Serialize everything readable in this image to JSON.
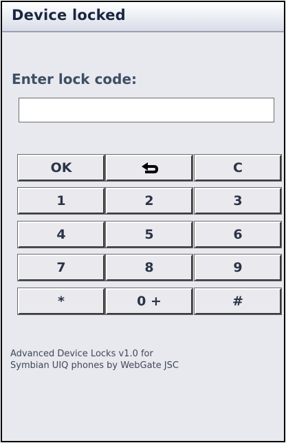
{
  "window": {
    "title": "Device locked"
  },
  "lock_form": {
    "prompt": "Enter lock code:",
    "code_value": ""
  },
  "keypad": {
    "ok": "OK",
    "backspace_icon": "backspace-arrow-icon",
    "clear": "C",
    "k1": "1",
    "k2": "2",
    "k3": "3",
    "k4": "4",
    "k5": "5",
    "k6": "6",
    "k7": "7",
    "k8": "8",
    "k9": "9",
    "star": "*",
    "zero": "0 +",
    "hash": "#"
  },
  "footer": {
    "line1": "Advanced Device Locks v1.0 for",
    "line2": "Symbian UIQ phones by WebGate JSC"
  },
  "colors": {
    "background": "#e8e8ef",
    "title_text": "#1a2740",
    "key_face": "#e9e9ee"
  }
}
